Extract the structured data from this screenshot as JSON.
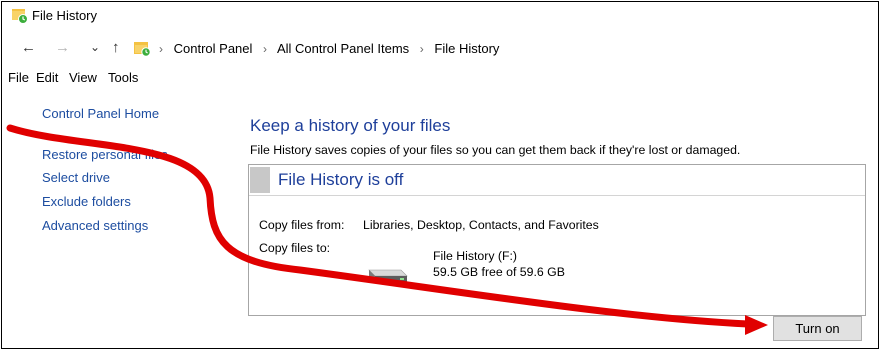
{
  "window": {
    "title": "File History"
  },
  "address": {
    "crumbs": [
      "Control Panel",
      "All Control Panel Items",
      "File History"
    ],
    "separator": "›"
  },
  "nav": {
    "back": "←",
    "forward": "→",
    "recent": "⌄",
    "up": "↑"
  },
  "menu": {
    "items": [
      "File",
      "Edit",
      "View",
      "Tools"
    ]
  },
  "sidebar": {
    "items": [
      {
        "label": "Control Panel Home"
      },
      {
        "label": "Restore personal files"
      },
      {
        "label": "Select drive"
      },
      {
        "label": "Exclude folders"
      },
      {
        "label": "Advanced settings"
      }
    ]
  },
  "main": {
    "heading": "Keep a history of your files",
    "description": "File History saves copies of your files so you can get them back if they're lost or damaged.",
    "status": {
      "title": "File History is off",
      "copy_from_label": "Copy files from:",
      "copy_from_value": "Libraries, Desktop, Contacts, and Favorites",
      "copy_to_label": "Copy files to:",
      "drive_name": "File History (F:)",
      "drive_free": "59.5 GB free of 59.6 GB"
    },
    "turn_on_label": "Turn on"
  },
  "colors": {
    "link": "#1d4da0",
    "heading": "#1e3f9a",
    "annotation_arrow": "#e00000"
  },
  "icons": {
    "app": "file-history-icon",
    "address": "control-panel-icon",
    "drive": "drive-icon"
  }
}
